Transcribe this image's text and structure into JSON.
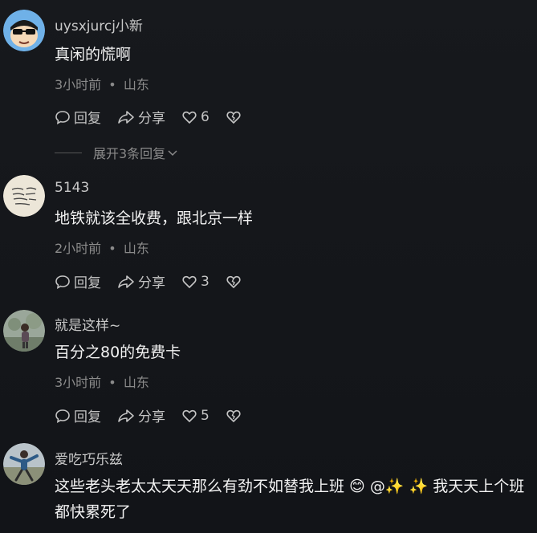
{
  "comments": [
    {
      "username": "uysxjurcj小新",
      "text": "真闲的慌啊",
      "time": "3小时前",
      "location": "山东",
      "reply_label": "回复",
      "share_label": "分享",
      "likes": "6",
      "expand_label": "展开3条回复"
    },
    {
      "username": "5143",
      "text": "地铁就该全收费，跟北京一样",
      "time": "2小时前",
      "location": "山东",
      "reply_label": "回复",
      "share_label": "分享",
      "likes": "3"
    },
    {
      "username": "就是这样~",
      "text": "百分之80的免费卡",
      "time": "3小时前",
      "location": "山东",
      "reply_label": "回复",
      "share_label": "分享",
      "likes": "5"
    },
    {
      "username": "爱吃巧乐兹",
      "text": "这些老头老太太天天那么有劲不如替我上班 😊 @✨ ✨ 我天天上个班都快累死了"
    }
  ],
  "separator": "•"
}
